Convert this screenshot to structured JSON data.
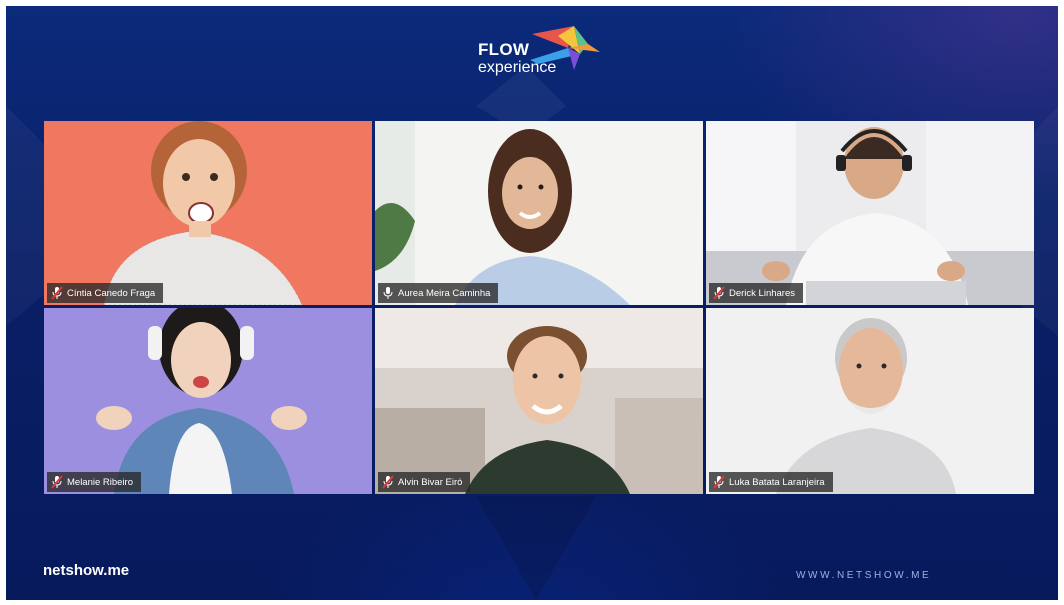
{
  "logo": {
    "line1": "FLOW",
    "line2": "experience"
  },
  "participants": [
    {
      "name": "Cíntia Canedo Fraga",
      "mic": "muted"
    },
    {
      "name": "Aurea Meira Caminha",
      "mic": "active"
    },
    {
      "name": "Derick Linhares",
      "mic": "muted"
    },
    {
      "name": "Melanie Ribeiro",
      "mic": "muted"
    },
    {
      "name": "Alvin Bivar Eiró",
      "mic": "muted"
    },
    {
      "name": "Luka Batata Laranjeira",
      "mic": "muted"
    }
  ],
  "footer": {
    "brand": "netshow.me",
    "url": "WWW.NETSHOW.ME"
  },
  "colors": {
    "background": "#0a1f66",
    "tile_1_bg": "#f07860",
    "tile_4_bg": "#9c8fe0",
    "muted_mic": "#d93a3a"
  }
}
